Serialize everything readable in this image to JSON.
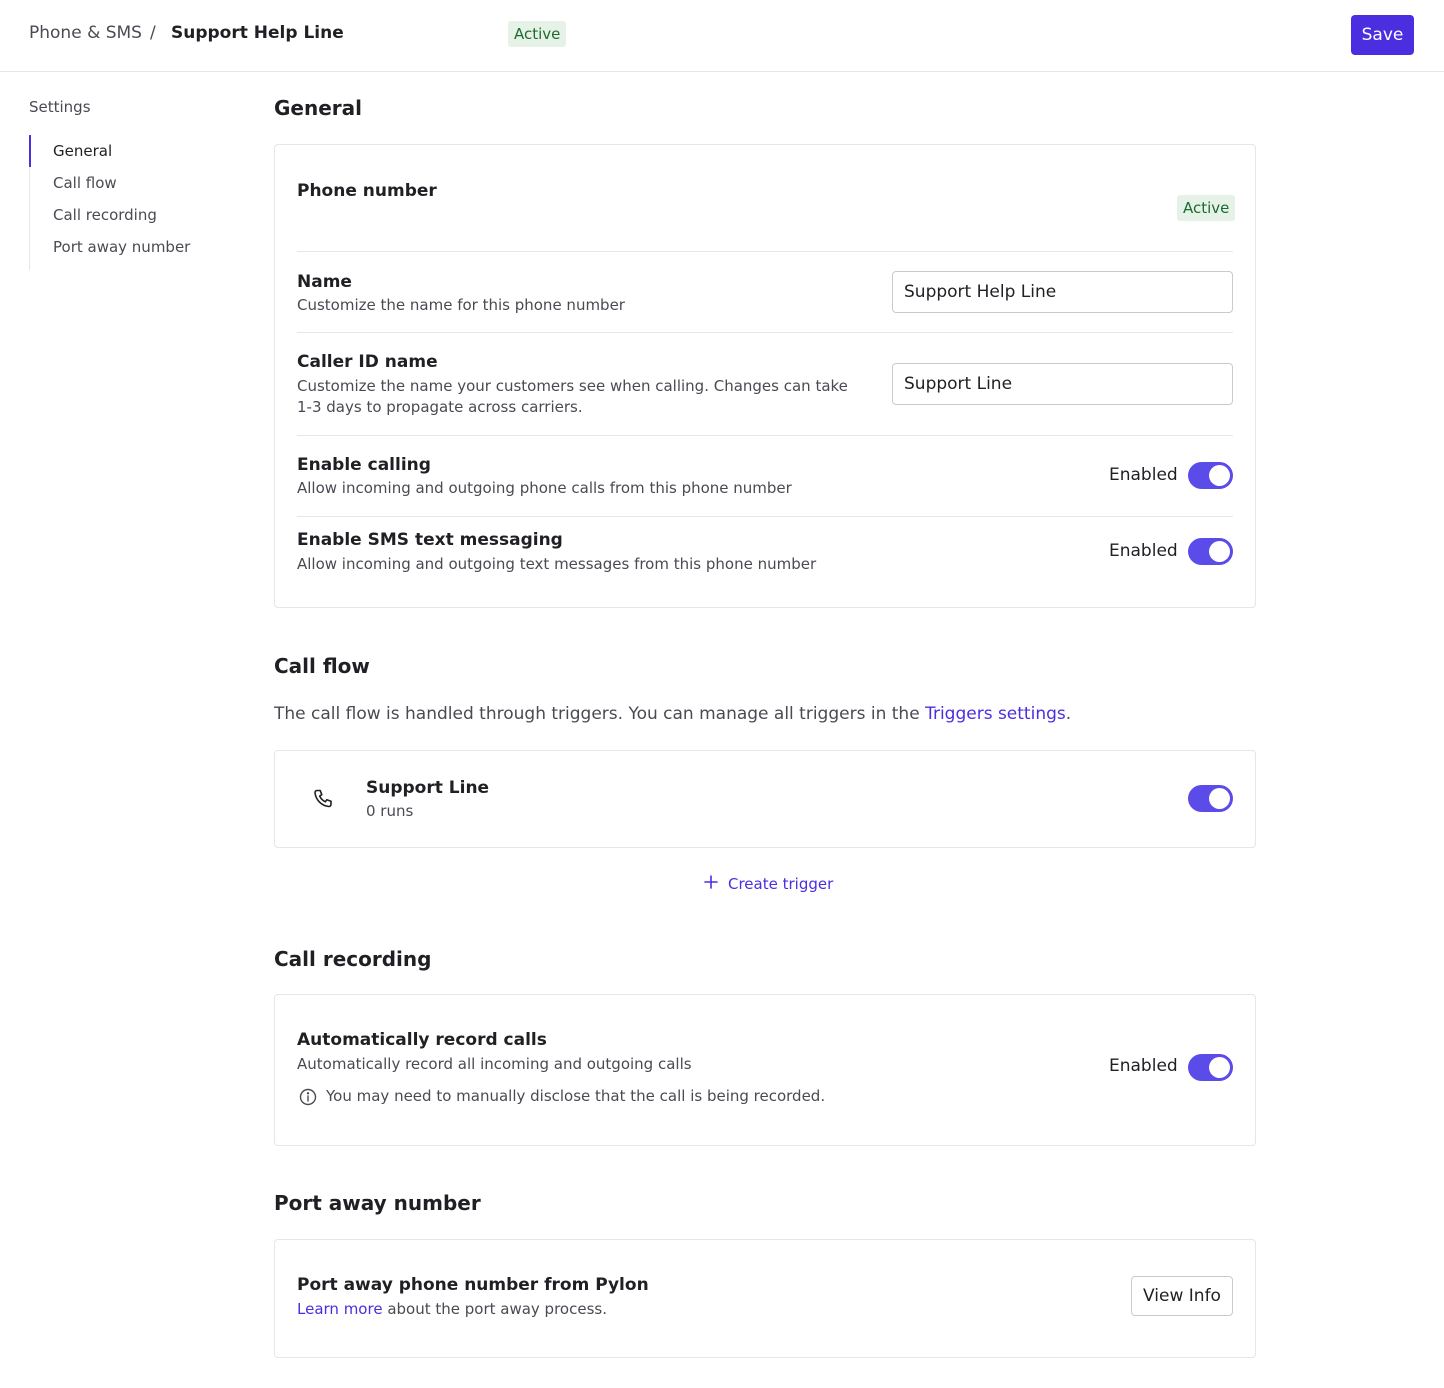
{
  "header": {
    "breadcrumb_root": "Phone & SMS",
    "breadcrumb_separator": "/",
    "breadcrumb_current": "Support Help Line",
    "status_badge": "Active",
    "save_label": "Save"
  },
  "sidebar": {
    "title": "Settings",
    "items": [
      {
        "label": "General",
        "active": true
      },
      {
        "label": "Call flow",
        "active": false
      },
      {
        "label": "Call recording",
        "active": false
      },
      {
        "label": "Port away number",
        "active": false
      }
    ]
  },
  "general": {
    "title": "General",
    "phone_number_label": "Phone number",
    "phone_status": "Active",
    "name": {
      "label": "Name",
      "description": "Customize the name for this phone number",
      "value": "Support Help Line"
    },
    "caller_id": {
      "label": "Caller ID name",
      "description": "Customize the name your customers see when calling. Changes can take 1-3 days to propagate across carriers.",
      "value": "Support Line"
    },
    "enable_calling": {
      "label": "Enable calling",
      "description": "Allow incoming and outgoing phone calls from this phone number",
      "state_label": "Enabled",
      "enabled": true
    },
    "enable_sms": {
      "label": "Enable SMS text messaging",
      "description": "Allow incoming and outgoing text messages from this phone number",
      "state_label": "Enabled",
      "enabled": true
    }
  },
  "call_flow": {
    "title": "Call flow",
    "description_prefix": "The call flow is handled through triggers. You can manage all triggers in the ",
    "link_text": "Triggers settings",
    "description_suffix": ".",
    "trigger": {
      "icon": "phone-icon",
      "name": "Support Line",
      "runs": "0 runs",
      "enabled": true
    },
    "create_trigger_label": "Create trigger"
  },
  "call_recording": {
    "title": "Call recording",
    "label": "Automatically record calls",
    "description": "Automatically record all incoming and outgoing calls",
    "notice": "You may need to manually disclose that the call is being recorded.",
    "state_label": "Enabled",
    "enabled": true
  },
  "port_away": {
    "title": "Port away number",
    "label": "Port away phone number from Pylon",
    "link_text": "Learn more",
    "description_suffix": " about the port away process.",
    "button_label": "View Info"
  },
  "colors": {
    "accent": "#4a2ee0",
    "toggle_on": "#5b4be8",
    "badge_bg": "#e6f1e7",
    "badge_text": "#1e6b2e"
  }
}
